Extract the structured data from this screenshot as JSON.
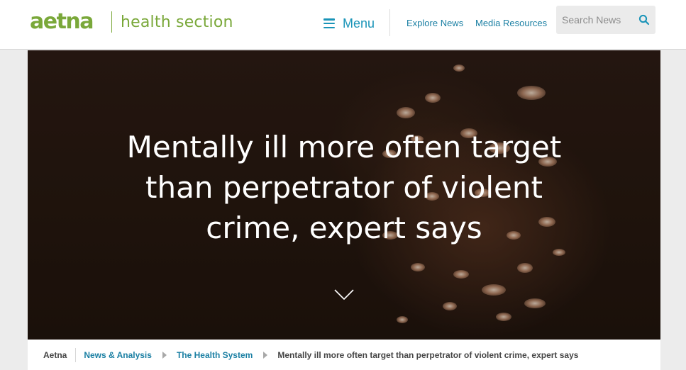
{
  "header": {
    "logo_text": "aetna",
    "section_name": "health section",
    "menu_label": "Menu",
    "nav": [
      {
        "label": "Explore News"
      },
      {
        "label": "Media Resources"
      }
    ],
    "search": {
      "placeholder": "Search News",
      "value": ""
    },
    "brand_color": "#7aa83a",
    "link_color": "#1a94b8"
  },
  "hero": {
    "title": "Mentally ill more often target than perpetrator of violent crime, expert says",
    "scroll_icon": "chevron-down-icon"
  },
  "breadcrumb": {
    "home": "Aetna",
    "items": [
      {
        "label": "News & Analysis"
      },
      {
        "label": "The Health System"
      }
    ],
    "current": "Mentally ill more often target than perpetrator of violent crime, expert says"
  }
}
